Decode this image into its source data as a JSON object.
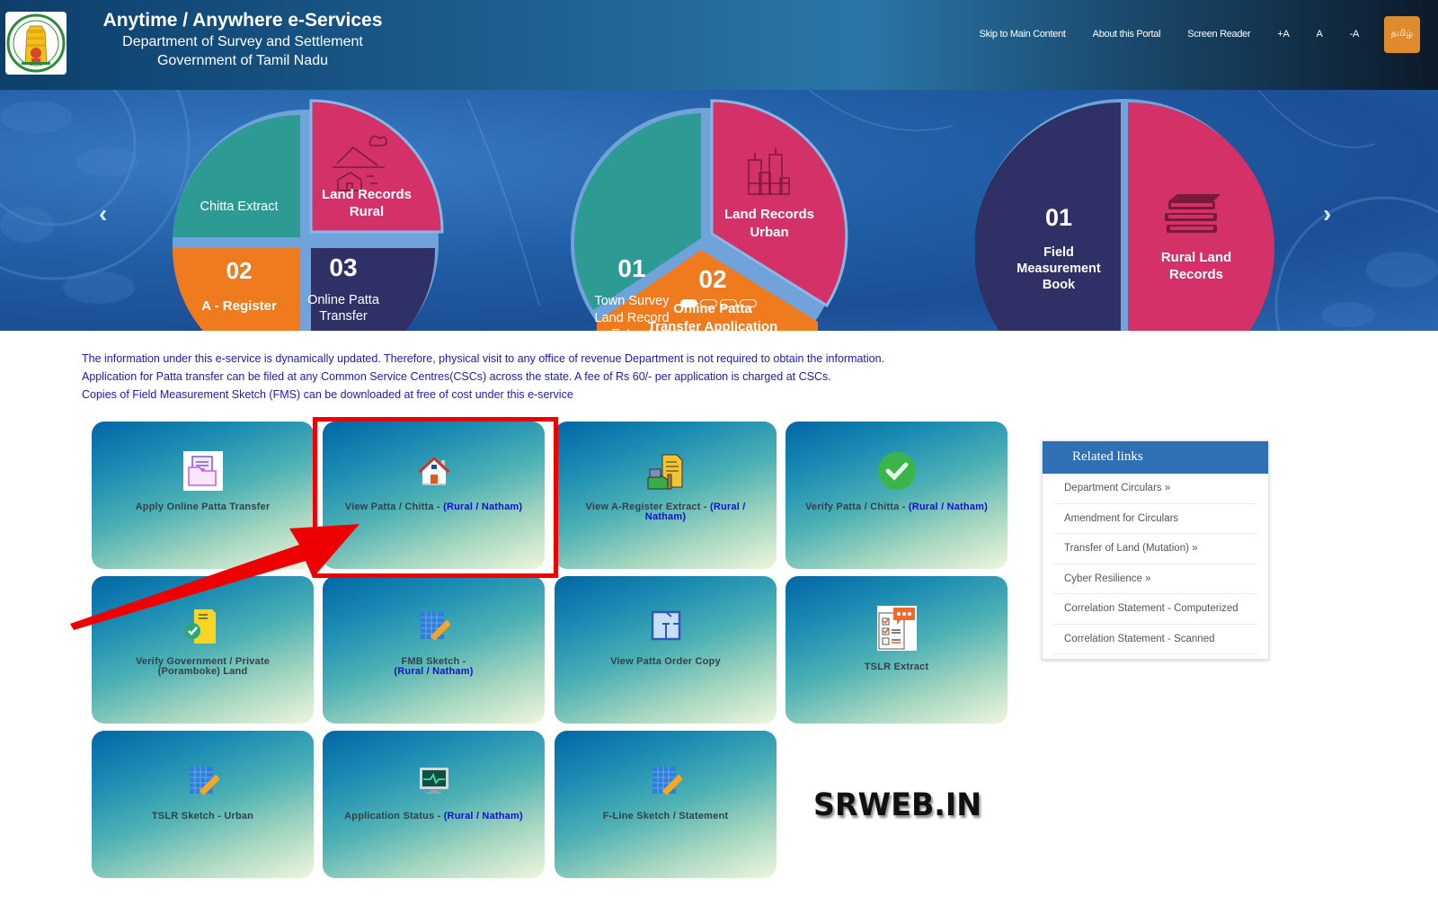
{
  "header": {
    "title": "Anytime / Anywhere e-Services",
    "subtitle1": "Department of Survey and Settlement",
    "subtitle2": "Government of Tamil Nadu",
    "logo_icon": "tamil-nadu-emblem-icon",
    "nav": [
      {
        "label": "Skip to Main Content"
      },
      {
        "label": "About this Portal"
      },
      {
        "label": "Screen Reader"
      },
      {
        "label": "+A"
      },
      {
        "label": "A"
      },
      {
        "label": "-A"
      }
    ],
    "language_button": "தமிழ்"
  },
  "carousel": {
    "prev_icon": "chevron-left-icon",
    "next_icon": "chevron-right-icon",
    "prev_glyph": "‹",
    "next_glyph": "›",
    "active_slide": 1,
    "slide_count": 4,
    "wheel1": {
      "chitta": "Chitta Extract",
      "land_rural_1": "Land Records",
      "land_rural_2": "Rural",
      "a_num": "02",
      "a_label": "A - Register",
      "opt_num": "03",
      "opt_label1": "Online Patta",
      "opt_label2": "Transfer"
    },
    "wheel2": {
      "tslr_num": "01",
      "tslr1": "Town Survey",
      "tslr2": "Land Record",
      "tslr3": "Extract",
      "urban1": "Land Records",
      "urban2": "Urban",
      "opt_num": "02",
      "opt_label1": "Online Patta",
      "opt_label2": "Transfer Application"
    },
    "wheel3": {
      "fmb_num": "01",
      "fmb1": "Field",
      "fmb2": "Measurement",
      "fmb3": "Book",
      "rural1": "Rural Land",
      "rural2": "Records"
    }
  },
  "info": {
    "lines": [
      "The information under this e-service is dynamically updated. Therefore, physical visit to any office of revenue Department is not required to obtain the information.",
      "Application for Patta transfer can be filed at any Common Service Centres(CSCs) across the state. A fee of Rs 60/- per application is charged at CSCs.",
      "Copies of Field Measurement Sketch (FMS) can be downloaded at free of cost under this e-service"
    ]
  },
  "tiles": [
    {
      "label": "Apply Online Patta Transfer",
      "suffix": "",
      "icon": "document-folder-icon"
    },
    {
      "label": "View Patta / Chitta - ",
      "suffix": "(Rural / Natham)",
      "icon": "house-icon"
    },
    {
      "label": "View A-Register Extract - ",
      "suffix": "(Rural / Natham)",
      "icon": "village-document-icon"
    },
    {
      "label": "Verify Patta / Chitta - ",
      "suffix": "(Rural / Natham)",
      "icon": "check-circle-icon"
    },
    {
      "label": "Verify Government / Private (Poramboke) Land",
      "suffix": "",
      "icon": "verified-document-icon"
    },
    {
      "label": "FMB Sketch - ",
      "suffix": "(Rural / Natham)",
      "icon": "grid-ruler-icon"
    },
    {
      "label": "View Patta Order Copy",
      "suffix": "",
      "icon": "floor-plan-icon"
    },
    {
      "label": "TSLR Extract",
      "suffix": "",
      "icon": "checklist-chat-icon"
    },
    {
      "label": "TSLR Sketch - Urban",
      "suffix": "",
      "icon": "grid-ruler-icon"
    },
    {
      "label": "Application Status - ",
      "suffix": "(Rural / Natham)",
      "icon": "monitor-pulse-icon"
    },
    {
      "label": "F-Line Sketch / Statement",
      "suffix": "",
      "icon": "grid-ruler-icon"
    }
  ],
  "related": {
    "title": "Related links",
    "items": [
      "Department Circulars »",
      "Amendment for Circulars",
      "Transfer of Land (Mutation) »",
      "Cyber Resilience »",
      "Correlation Statement - Computerized",
      "Correlation Statement - Scanned"
    ]
  },
  "annotation": {
    "highlighted_tile": "View Patta / Chitta - (Rural / Natham)",
    "arrow_color": "#ee0000"
  },
  "watermark": "SRWEB.IN",
  "colors": {
    "header_start": "#0d3f6b",
    "language_button": "#e08a2e",
    "info_text": "#1c1ca8",
    "tile_highlight_text": "#1111cc",
    "related_header": "#2f6fb3",
    "wheel_teal": "#2e9a94",
    "wheel_pink": "#d43168",
    "wheel_orange": "#f07a1e",
    "wheel_navy": "#2f3166"
  }
}
